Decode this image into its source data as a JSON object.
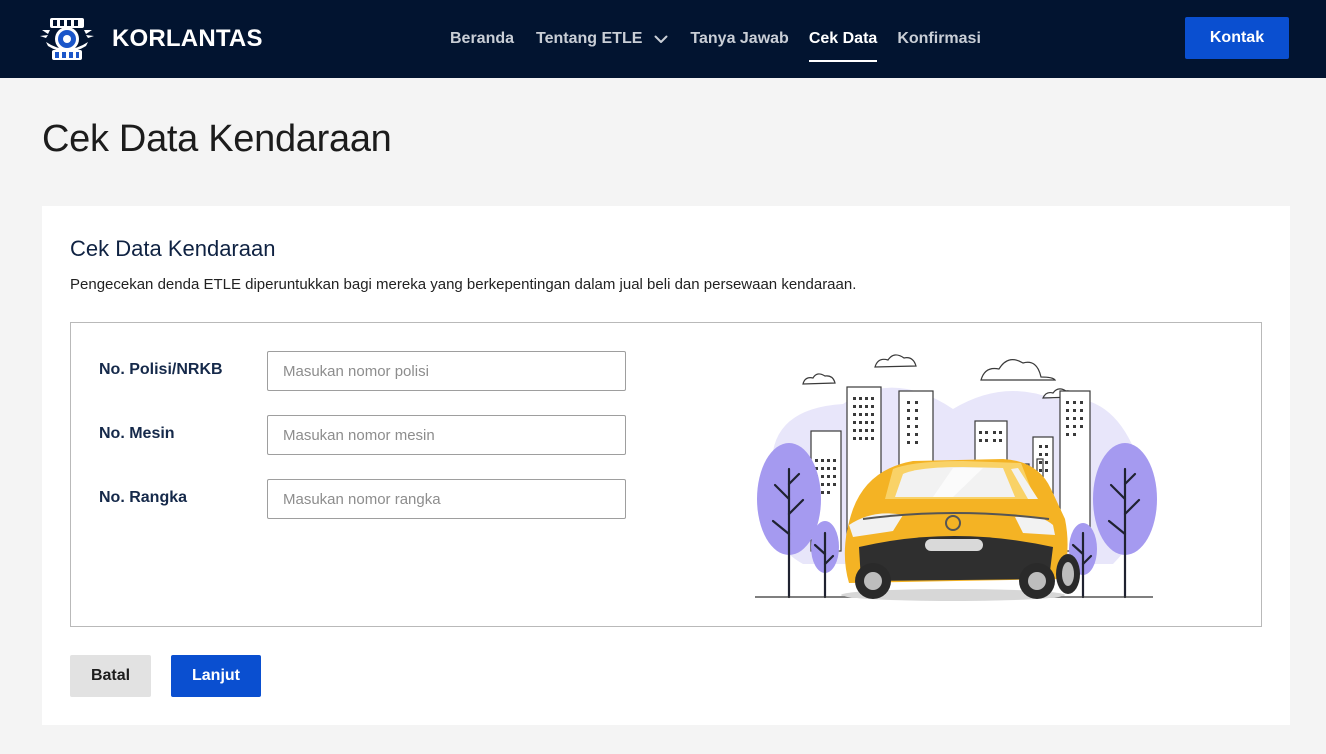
{
  "header": {
    "brand": "KORLANTAS",
    "logo_icon": "korlantas-emblem-icon",
    "nav": [
      {
        "label": "Beranda",
        "active": false
      },
      {
        "label": "Tentang ETLE",
        "active": false,
        "has_dropdown": true
      },
      {
        "label": "Tanya Jawab",
        "active": false
      },
      {
        "label": "Cek Data",
        "active": true
      },
      {
        "label": "Konfirmasi",
        "active": false
      }
    ],
    "contact_button": "Kontak"
  },
  "page": {
    "title": "Cek Data Kendaraan"
  },
  "card": {
    "title": "Cek Data Kendaraan",
    "description": "Pengecekan denda ETLE diperuntukkan bagi mereka yang berkepentingan dalam jual beli dan persewaan kendaraan.",
    "fields": [
      {
        "label": "No. Polisi/NRKB",
        "placeholder": "Masukan nomor polisi",
        "value": ""
      },
      {
        "label": "No. Mesin",
        "placeholder": "Masukan nomor mesin",
        "value": ""
      },
      {
        "label": "No. Rangka",
        "placeholder": "Masukan nomor rangka",
        "value": ""
      }
    ],
    "illustration": "yellow-car-city-illustration",
    "cancel_button": "Batal",
    "next_button": "Lanjut"
  },
  "colors": {
    "header_bg": "#021430",
    "primary": "#0a4fd0",
    "page_bg": "#f4f4f4",
    "heading": "#0f2242"
  }
}
